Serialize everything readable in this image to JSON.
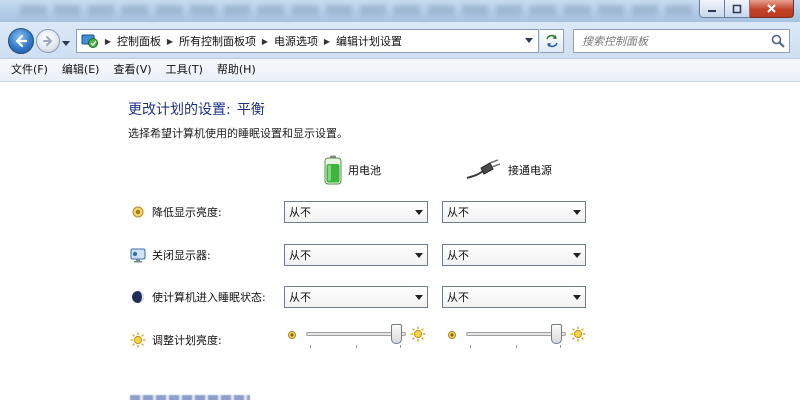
{
  "window": {
    "buttons": {
      "min_icon": "minimize-icon",
      "max_icon": "maximize-icon",
      "close_icon": "close-icon"
    }
  },
  "address_bar": {
    "breadcrumbs": [
      "控制面板",
      "所有控制面板项",
      "电源选项",
      "编辑计划设置"
    ],
    "icon": "control-panel-icon"
  },
  "search": {
    "placeholder": "搜索控制面板"
  },
  "menu": [
    "文件(F)",
    "编辑(E)",
    "查看(V)",
    "工具(T)",
    "帮助(H)"
  ],
  "page": {
    "title_prefix": "更改计划的设置:",
    "plan_name": "平衡",
    "subtitle": "选择希望计算机使用的睡眠设置和显示设置。"
  },
  "columns": {
    "battery": {
      "label": "用电池",
      "icon": "battery-icon"
    },
    "plugged": {
      "label": "接通电源",
      "icon": "power-plug-icon"
    }
  },
  "settings": [
    {
      "label": "降低显示亮度:",
      "icon": "dim-brightness-icon",
      "battery": "从不",
      "plugged": "从不"
    },
    {
      "label": "关闭显示器:",
      "icon": "monitor-icon",
      "battery": "从不",
      "plugged": "从不"
    },
    {
      "label": "使计算机进入睡眠状态:",
      "icon": "sleep-moon-icon",
      "battery": "从不",
      "plugged": "从不"
    }
  ],
  "brightness": {
    "label": "调整计划亮度:",
    "icon": "sun-icon",
    "battery_level": 0.95,
    "plugged_level": 0.95
  },
  "colors": {
    "title_blue": "#1e3287",
    "chrome_blue": "#cfdff1"
  }
}
